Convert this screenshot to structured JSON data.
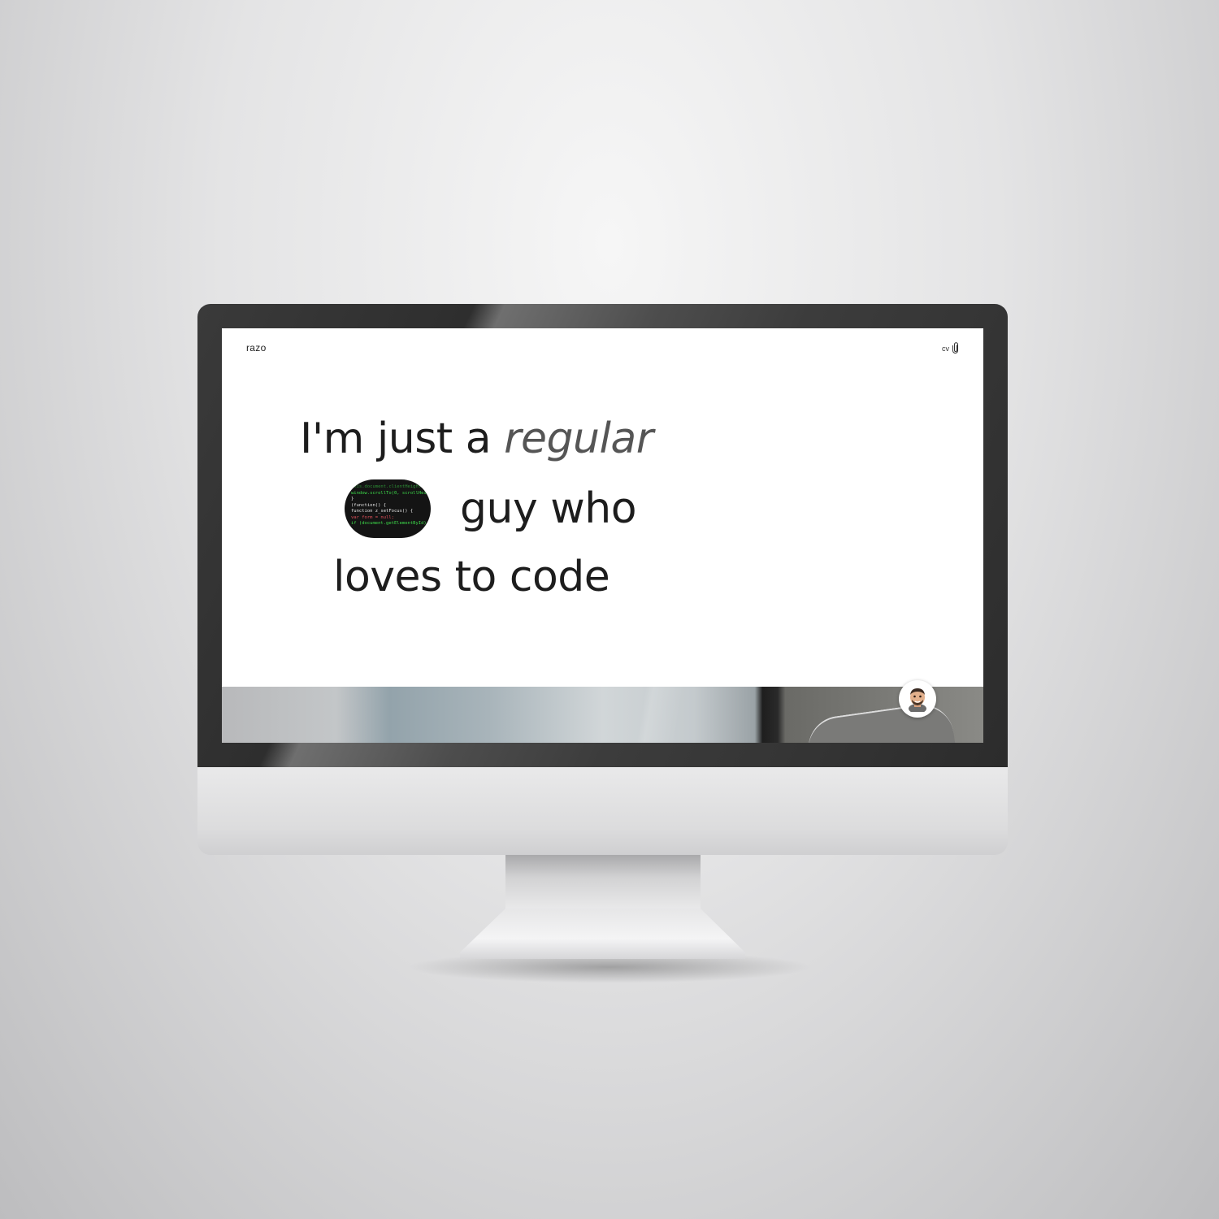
{
  "site": {
    "logo": "razo",
    "cv_label": "cv"
  },
  "headline": {
    "part1": "I'm just a ",
    "part1_italic": "regular",
    "part2": "guy who",
    "part3": "loves to code"
  },
  "code_snippet": [
    "this.document.clientHeight = 0;",
    "window.scrollTo(0, scrollHeight);",
    "}",
    "(function() {",
    "function z_setFocus() {",
    "var form = null;",
    "if (document.getElementById) {"
  ],
  "colors": {
    "text": "#1d1d1d",
    "italic_text": "#555555",
    "code_bg": "#141414",
    "code_green": "#3ddc4a",
    "code_red": "#e0505a",
    "code_white": "#e6e6e6",
    "code_purple": "#c27bd6"
  },
  "icons": {
    "cv": "paperclip-icon",
    "avatar": "memoji-avatar-icon"
  }
}
